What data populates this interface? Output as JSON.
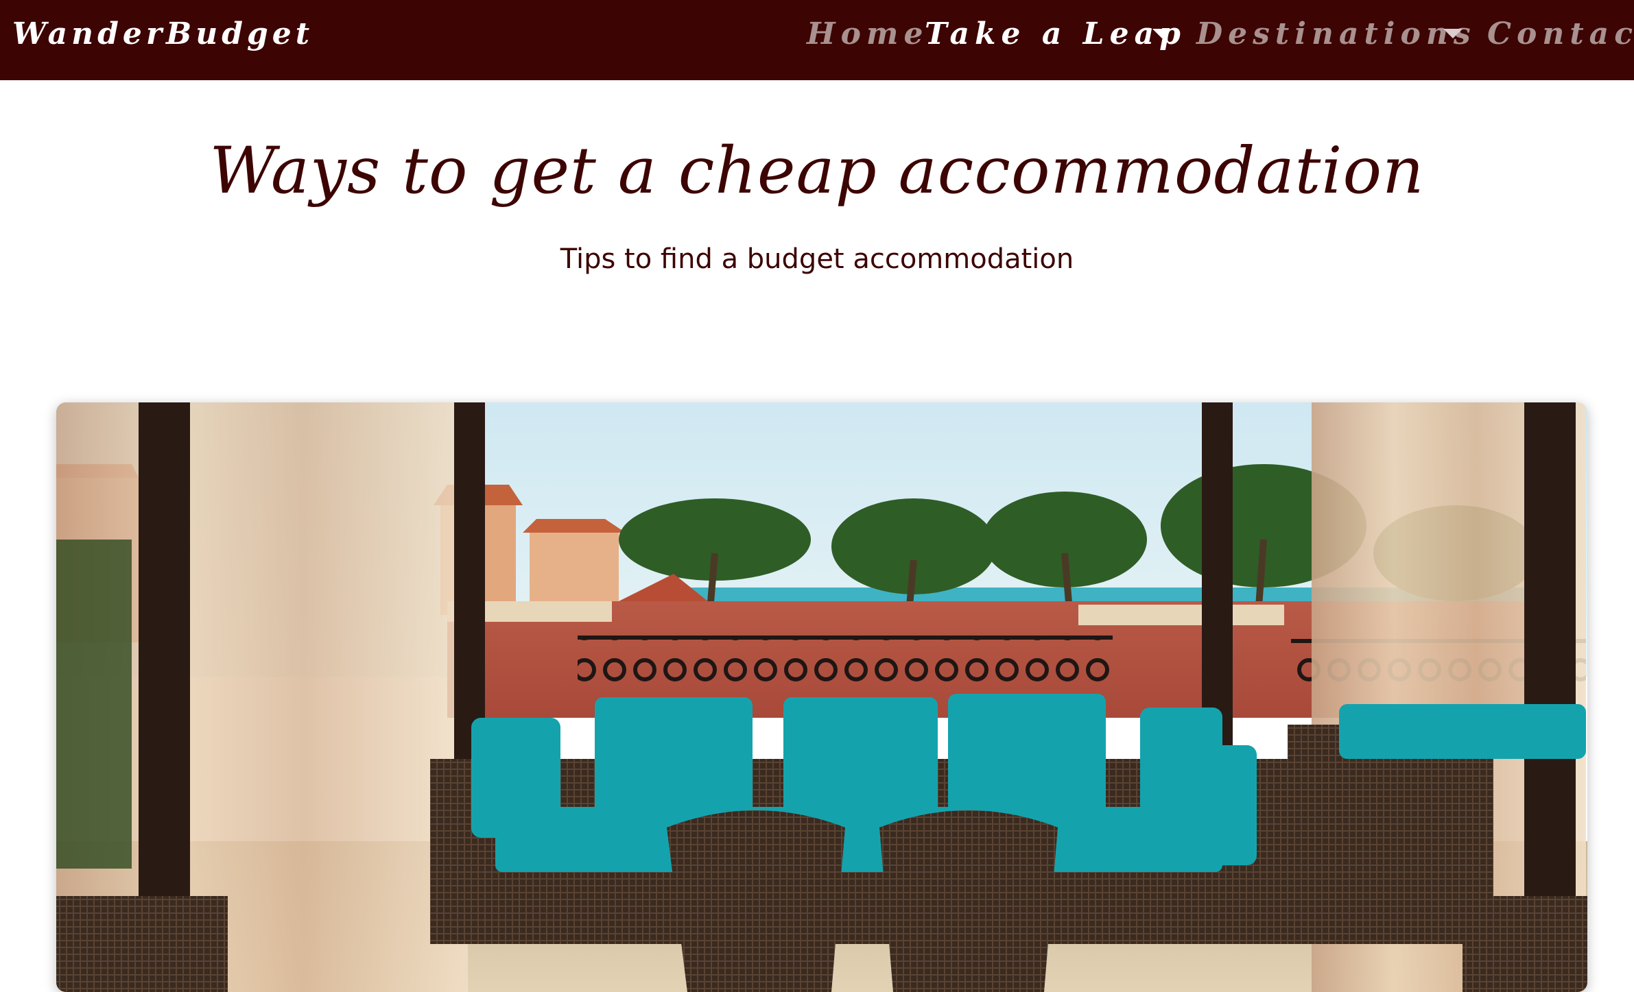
{
  "nav": {
    "brand": "WanderBudget",
    "items": [
      {
        "label": "Home",
        "active": false,
        "dropdown": false
      },
      {
        "label": "Take a Leap",
        "active": true,
        "dropdown": true
      },
      {
        "label": "Destinations",
        "active": false,
        "dropdown": true
      },
      {
        "label": "Contact",
        "active": false,
        "dropdown": false
      }
    ]
  },
  "header": {
    "title": "Ways to get a cheap accommodation",
    "subtitle": "Tips to find a budget accommodation"
  },
  "colors": {
    "navbar_bg": "#3d0404",
    "title_text": "#3d0404",
    "nav_active": "#ffffff",
    "nav_inactive": "#a8918f",
    "cushion_teal": "#14a3ad"
  }
}
